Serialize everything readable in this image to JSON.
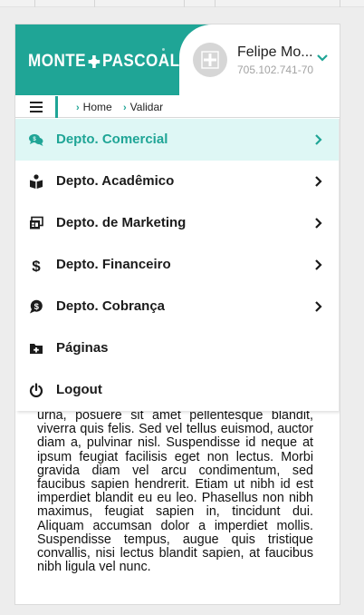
{
  "header": {
    "logo_left": "MONTE",
    "logo_right": "PASCOAL",
    "brand_color": "#1fa596"
  },
  "user": {
    "name": "Felipe Mo...",
    "id": "705.102.741-70"
  },
  "breadcrumb": {
    "items": [
      "Home",
      "Validar"
    ]
  },
  "menu": {
    "items": [
      {
        "label": "Depto. Comercial",
        "icon": "comments-dollar-icon",
        "active": true,
        "has_submenu": true
      },
      {
        "label": "Depto. Acadêmico",
        "icon": "book-reader-icon",
        "active": false,
        "has_submenu": true
      },
      {
        "label": "Depto. de Marketing",
        "icon": "ad-icon",
        "active": false,
        "has_submenu": true
      },
      {
        "label": "Depto. Financeiro",
        "icon": "dollar-icon",
        "active": false,
        "has_submenu": true
      },
      {
        "label": "Depto. Cobrança",
        "icon": "comment-dollar-icon",
        "active": false,
        "has_submenu": true
      },
      {
        "label": "Páginas",
        "icon": "folder-plus-icon",
        "active": false,
        "has_submenu": false
      },
      {
        "label": "Logout",
        "icon": "power-icon",
        "active": false,
        "has_submenu": false
      }
    ]
  },
  "content": {
    "text": "urna, posuere sit amet pellentesque blandit, viverra quis felis. Sed vel tellus euismod, auctor diam a, pulvinar nisl. Suspendisse id neque at ipsum feugiat facilisis eget non lectus. Morbi gravida diam vel arcu condimentum, sed faucibus sapien hendrerit. Etiam ut nibh id est imperdiet blandit eu eu leo. Phasellus non nibh maximus, feugiat sapien in, tincidunt dui. Aliquam accumsan dolor a imperdiet mollis. Suspendisse tempus, augue quis tristique convallis, nisi lectus blandit sapien, at faucibus nibh ligula vel nunc."
  }
}
